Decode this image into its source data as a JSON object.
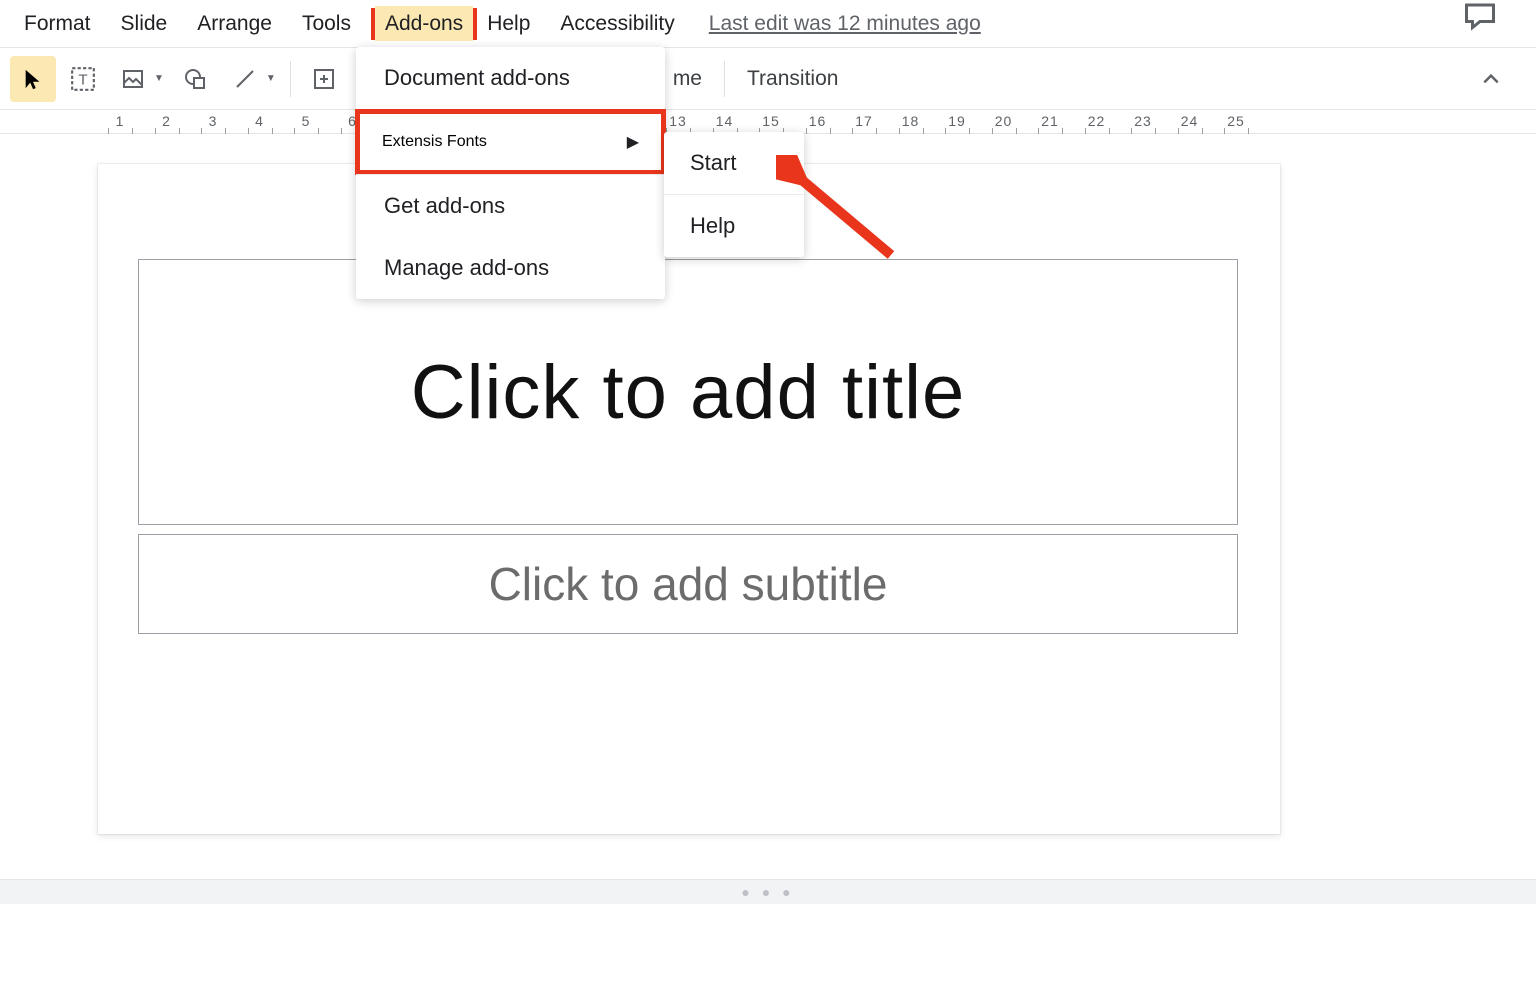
{
  "menubar": {
    "items": [
      "Format",
      "Slide",
      "Arrange",
      "Tools",
      "Add-ons",
      "Help",
      "Accessibility"
    ],
    "active_index": 4,
    "last_edit": "Last edit was 12 minutes ago"
  },
  "toolbar": {
    "theme_fragment": "me",
    "transition": "Transition"
  },
  "ruler": {
    "start": 1,
    "end": 25
  },
  "slide": {
    "title_placeholder": "Click to add title",
    "subtitle_placeholder": "Click to add subtitle"
  },
  "addons_menu": {
    "document_addons": "Document add-ons",
    "extensis_fonts": "Extensis Fonts",
    "get_addons": "Get add-ons",
    "manage_addons": "Manage add-ons"
  },
  "submenu": {
    "start": "Start",
    "help": "Help"
  },
  "icons": {
    "select": "select-icon",
    "textbox": "textbox-icon",
    "image": "image-icon",
    "shape": "shape-icon",
    "line": "line-icon",
    "insert_box": "insert-box-icon",
    "comment": "comment-icon",
    "chevron_up": "chevron-up-icon"
  },
  "colors": {
    "highlight_red": "#e8351b",
    "menu_yellow": "#fce8b2"
  }
}
